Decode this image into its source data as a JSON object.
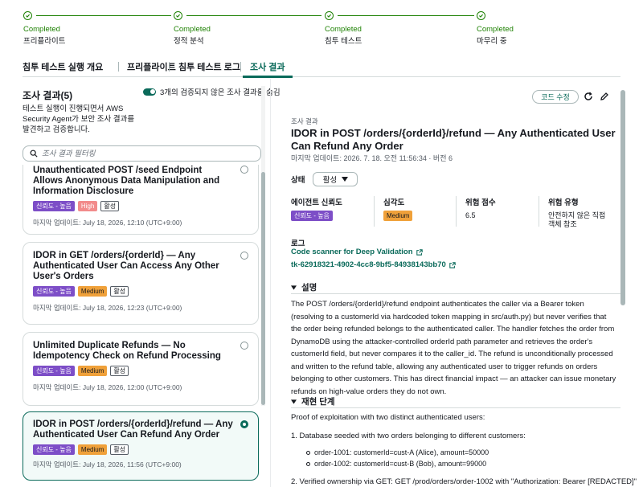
{
  "stepper": [
    {
      "status": "Completed",
      "name": "프리플라이트"
    },
    {
      "status": "Completed",
      "name": "정적 분석"
    },
    {
      "status": "Completed",
      "name": "침투 테스트"
    },
    {
      "status": "Completed",
      "name": "마무리 중"
    }
  ],
  "tabs": [
    "침투 테스트 실행 개요",
    "프리플라이트",
    "침투 테스트 로그",
    "조사 결과"
  ],
  "left": {
    "title": "조사 결과(5)",
    "toggle_label": "3개의 검증되지 않은 조사 결과를 숨김",
    "description": "테스트 실행이 진행되면서 AWS Security Agent가 보안 조사 결과를 발견하고 검증합니다.",
    "search_placeholder": "조사 결과 필터링",
    "findings": [
      {
        "title": "Unauthenticated POST /seed Endpoint Allows Anonymous Data Manipulation and Information Disclosure",
        "badges": [
          "신뢰도 - 높음",
          "High",
          "활성"
        ],
        "date": "마지막 업데이트: July 18, 2026, 12:10 (UTC+9:00)"
      },
      {
        "title": "IDOR in GET /orders/{orderId} — Any Authenticated User Can Access Any Other User's Orders",
        "badges": [
          "신뢰도 - 높음",
          "Medium",
          "활성"
        ],
        "date": "마지막 업데이트: July 18, 2026, 12:23 (UTC+9:00)"
      },
      {
        "title": "Unlimited Duplicate Refunds — No Idempotency Check on Refund Processing",
        "badges": [
          "신뢰도 - 높음",
          "Medium",
          "활성"
        ],
        "date": "마지막 업데이트: July 18, 2026, 12:00 (UTC+9:00)"
      },
      {
        "title": "IDOR in POST /orders/{orderId}/refund — Any Authenticated User Can Refund Any Order",
        "badges": [
          "신뢰도 - 높음",
          "Medium",
          "활성"
        ],
        "date": "마지막 업데이트: July 18, 2026, 11:56 (UTC+9:00)"
      }
    ]
  },
  "detail": {
    "code_button": "코드 수정",
    "section_label": "조사 결과",
    "title": "IDOR in POST /orders/{orderId}/refund — Any Authenticated User Can Refund Any Order",
    "meta": "마지막 업데이트: 2026. 7. 18. 오전 11:56:34 · 버전 6",
    "status_label": "상태",
    "status_value": "활성",
    "kv": [
      {
        "k": "에이전트 신뢰도",
        "v": "신뢰도 - 높음"
      },
      {
        "k": "심각도",
        "v": "Medium"
      },
      {
        "k": "위험 점수",
        "v": "6.5"
      },
      {
        "k": "위험 유형",
        "v": "안전하지 않은 직접 객체 참조"
      }
    ],
    "log_label": "로그",
    "log_link1": "Code scanner for Deep Validation",
    "log_link2": "tk-62918321-4902-4cc8-9bf5-84938143bb70",
    "desc_head": "설명",
    "description": "The POST /orders/{orderId}/refund endpoint authenticates the caller via a Bearer token (resolving to a customerId via hardcoded token mapping in src/auth.py) but never verifies that the order being refunded belongs to the authenticated caller. The handler fetches the order from DynamoDB using the attacker-controlled orderId path parameter and retrieves the order's customerId field, but never compares it to the caller_id. The refund is unconditionally processed and written to the refund table, allowing any authenticated user to trigger refunds on orders belonging to other customers. This has direct financial impact — an attacker can issue monetary refunds on high-value orders they do not own.",
    "repro_head": "재현 단계",
    "repro_intro": "Proof of exploitation with two distinct authenticated users:",
    "repro_step1": "1.  Database seeded with two orders belonging to different customers:",
    "repro_sub1": "order-1001: customerId=cust-A (Alice), amount=50000",
    "repro_sub2": "order-1002: customerId=cust-B (Bob), amount=99000",
    "repro_step2": "2.  Verified ownership via GET: GET /prod/orders/order-1002 with \"Authorization: Bearer [REDACTED]\""
  }
}
